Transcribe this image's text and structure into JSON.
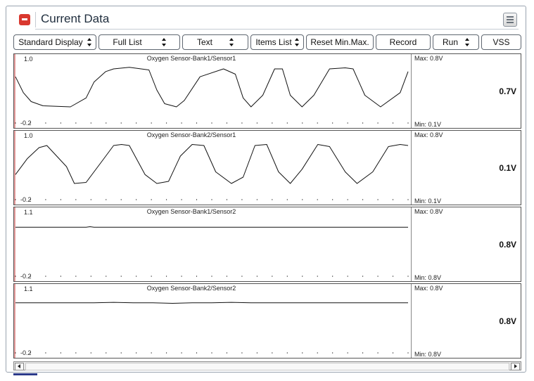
{
  "window": {
    "title": "Current Data",
    "icons": {
      "collapse": "collapse-icon",
      "menu": "hamburger-menu-icon"
    },
    "accent_color": "#d9382f"
  },
  "toolbar": [
    {
      "label": "Standard Display",
      "dropdown": true
    },
    {
      "label": "Full List",
      "dropdown": true
    },
    {
      "label": "Text",
      "dropdown": true
    },
    {
      "label": "Items List",
      "dropdown": true
    },
    {
      "label": "Reset Min.Max.",
      "dropdown": false
    },
    {
      "label": "Record",
      "dropdown": false
    },
    {
      "label": "Run",
      "dropdown": true
    },
    {
      "label": "VSS",
      "dropdown": false
    }
  ],
  "chart_data": [
    {
      "type": "line",
      "title": "Oxygen Sensor-Bank1/Sensor1",
      "ylim": [
        -0.2,
        1.0
      ],
      "ymax_label": "1.0",
      "ymin_label": "-0.2",
      "max_label": "Max:",
      "max_value": "0.8V",
      "min_label": "Min:",
      "min_value": "0.1V",
      "current_value": "0.7V",
      "x": [
        0,
        2,
        4,
        7,
        14,
        18,
        20,
        23,
        25,
        29,
        34,
        36,
        38,
        41,
        43,
        47,
        53,
        56,
        58,
        60,
        63,
        66,
        68,
        70,
        73,
        76,
        80,
        84,
        86,
        89,
        93,
        98,
        100
      ],
      "y": [
        0.65,
        0.35,
        0.18,
        0.1,
        0.08,
        0.25,
        0.55,
        0.75,
        0.8,
        0.83,
        0.78,
        0.4,
        0.14,
        0.08,
        0.2,
        0.65,
        0.8,
        0.7,
        0.25,
        0.08,
        0.3,
        0.8,
        0.8,
        0.3,
        0.08,
        0.3,
        0.8,
        0.82,
        0.8,
        0.3,
        0.08,
        0.35,
        0.75
      ]
    },
    {
      "type": "line",
      "title": "Oxygen Sensor-Bank2/Sensor1",
      "ylim": [
        -0.2,
        1.0
      ],
      "ymax_label": "1.0",
      "ymin_label": "-0.2",
      "max_label": "Max:",
      "max_value": "0.8V",
      "min_label": "Min:",
      "min_value": "0.1V",
      "current_value": "0.1V",
      "x": [
        0,
        3,
        6,
        8,
        13,
        15,
        18,
        22,
        25,
        27,
        29,
        33,
        36,
        39,
        42,
        45,
        48,
        51,
        55,
        58,
        61,
        64,
        67,
        70,
        73,
        77,
        80,
        84,
        87,
        91,
        95,
        98,
        100
      ],
      "y": [
        0.25,
        0.55,
        0.76,
        0.8,
        0.4,
        0.08,
        0.1,
        0.5,
        0.8,
        0.82,
        0.8,
        0.25,
        0.08,
        0.12,
        0.6,
        0.82,
        0.8,
        0.3,
        0.08,
        0.2,
        0.8,
        0.82,
        0.3,
        0.08,
        0.35,
        0.82,
        0.78,
        0.3,
        0.08,
        0.3,
        0.78,
        0.82,
        0.8
      ]
    },
    {
      "type": "line",
      "title": "Oxygen Sensor-Bank1/Sensor2",
      "ylim": [
        -0.2,
        1.1
      ],
      "ymax_label": "1.1",
      "ymin_label": "-0.2",
      "max_label": "Max:",
      "max_value": "0.8V",
      "min_label": "Min:",
      "min_value": "0.8V",
      "current_value": "0.8V",
      "x": [
        0,
        18,
        19,
        20,
        40,
        60,
        80,
        100
      ],
      "y": [
        0.78,
        0.78,
        0.79,
        0.78,
        0.78,
        0.78,
        0.78,
        0.78
      ]
    },
    {
      "type": "line",
      "title": "Oxygen Sensor-Bank2/Sensor2",
      "ylim": [
        -0.2,
        1.1
      ],
      "ymax_label": "1.1",
      "ymin_label": "-0.2",
      "max_label": "Max:",
      "max_value": "0.8V",
      "min_label": "Min:",
      "min_value": "0.8V",
      "current_value": "0.8V",
      "x": [
        0,
        20,
        25,
        30,
        35,
        40,
        45,
        50,
        55,
        60,
        100
      ],
      "y": [
        0.8,
        0.8,
        0.81,
        0.8,
        0.8,
        0.79,
        0.8,
        0.8,
        0.81,
        0.8,
        0.8
      ]
    }
  ],
  "scrollbar": {
    "icons": {
      "left": "scroll-left-arrow-icon",
      "right": "scroll-right-arrow-icon"
    }
  }
}
